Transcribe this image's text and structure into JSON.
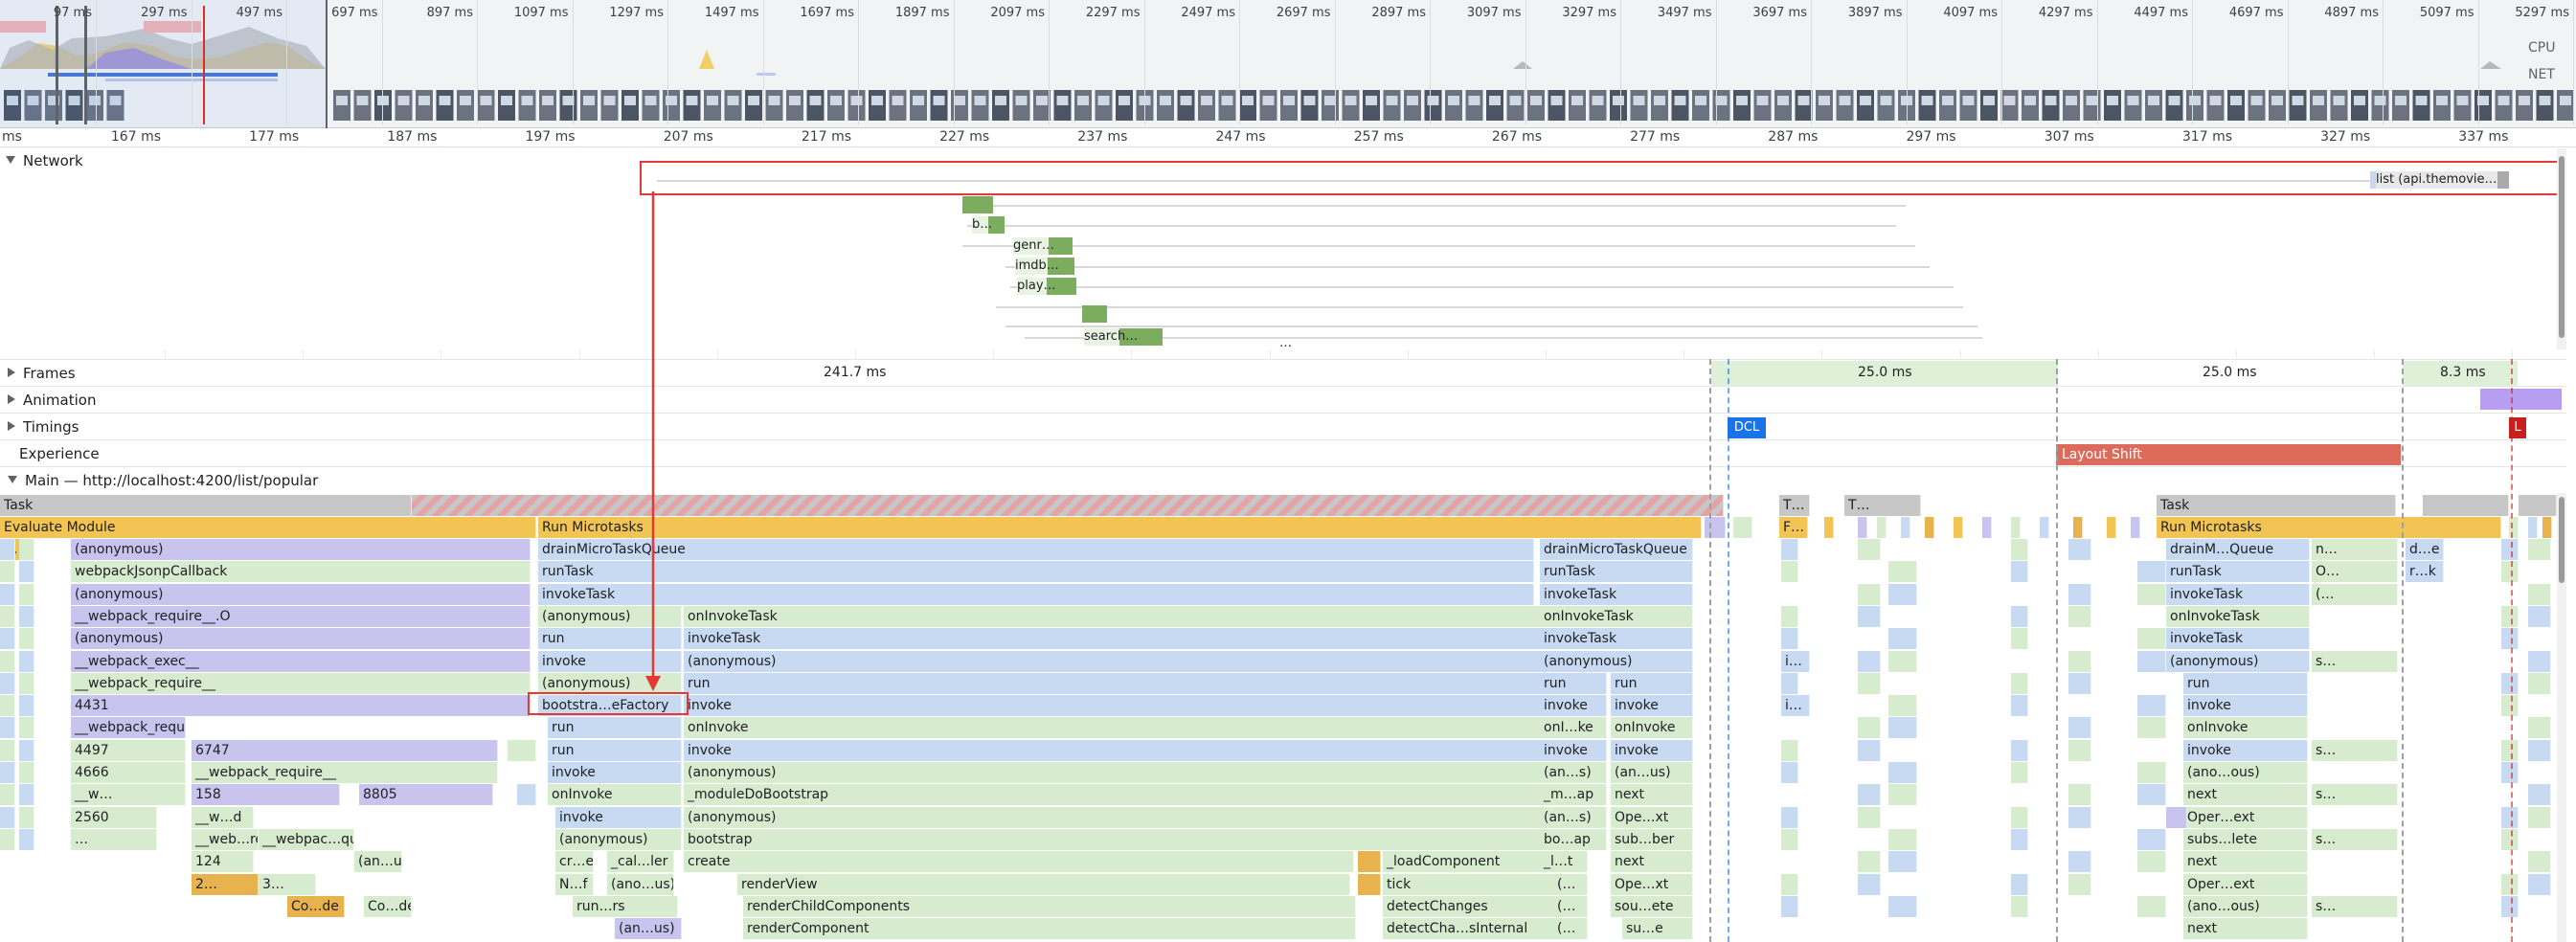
{
  "overview": {
    "ticks": [
      "97 ms",
      "297 ms",
      "497 ms",
      "697 ms",
      "897 ms",
      "1097 ms",
      "1297 ms",
      "1497 ms",
      "1697 ms",
      "1897 ms",
      "2097 ms",
      "2297 ms",
      "2497 ms",
      "2697 ms",
      "2897 ms",
      "3097 ms",
      "3297 ms",
      "3497 ms",
      "3697 ms",
      "3897 ms",
      "4097 ms",
      "4297 ms",
      "4497 ms",
      "4697 ms",
      "4897 ms",
      "5097 ms",
      "5297 ms"
    ],
    "cpu_label": "CPU",
    "net_label": "NET"
  },
  "ruler": {
    "ticks": [
      "ms",
      "167 ms",
      "177 ms",
      "187 ms",
      "197 ms",
      "207 ms",
      "217 ms",
      "227 ms",
      "237 ms",
      "247 ms",
      "257 ms",
      "267 ms",
      "277 ms",
      "287 ms",
      "297 ms",
      "307 ms",
      "317 ms",
      "327 ms",
      "337 ms"
    ]
  },
  "network": {
    "label": "Network",
    "requests": [
      {
        "label": "list (api.themovie…"
      },
      {
        "label": ""
      },
      {
        "label": "b…"
      },
      {
        "label": "genr…"
      },
      {
        "label": "imdb…"
      },
      {
        "label": "play…"
      },
      {
        "label": ""
      },
      {
        "label": "search…"
      }
    ],
    "more": "…"
  },
  "tracks": {
    "frames": "Frames",
    "frames_durations": [
      "241.7 ms",
      "25.0 ms",
      "25.0 ms",
      "8.3 ms"
    ],
    "animation": "Animation",
    "timings": "Timings",
    "dcl": "DCL",
    "lcp": "L",
    "experience": "Experience",
    "layout_shift": "Layout Shift",
    "main": "Main — http://localhost:4200/list/popular"
  },
  "flame": {
    "task": "Task",
    "task_small": [
      "T…",
      "T…",
      "Task"
    ],
    "evaluate_module": "Evaluate Module",
    "run_microtasks": "Run Microtasks",
    "run_microtasks_right": "Run Microtasks",
    "f_short": "F…",
    "left_stack": [
      "(anonymous)",
      "webpackJsonpCallback",
      "(anonymous)",
      "__webpack_require__.O",
      "(anonymous)",
      "__webpack_exec__",
      "__webpack_require__",
      "4431",
      "__webpack_require__",
      "4497",
      "4666",
      "__w…",
      "2560",
      "…"
    ],
    "left_col2": [
      "6747",
      "__webpack_require__",
      "158",
      "8805",
      "__w…d",
      "__web…re__",
      "__webpac…quire__",
      "124",
      "2…",
      "3…",
      "Co…de",
      "(an…us)",
      "Co…de"
    ],
    "c_short": "C…",
    "mid_stack": [
      "drainMicroTaskQueue",
      "runTask",
      "invokeTask",
      "(anonymous)",
      "run",
      "invoke",
      "(anonymous)",
      "bootstra…eFactory",
      "run",
      "run",
      "invoke",
      "onInvoke",
      "invoke",
      "(anonymous)",
      "cr…e",
      "N…f",
      "run…rs"
    ],
    "mid_col2": [
      "onInvokeTask",
      "invokeTask",
      "(anonymous)",
      "run",
      "invoke",
      "onInvoke",
      "invoke",
      "(anonymous)",
      "_moduleDoBootstrap",
      "(anonymous)",
      "bootstrap",
      "create",
      "_cal…ler",
      "(ano…us)",
      "(an…us)",
      "renderView",
      "renderChildComponents",
      "renderComponent"
    ],
    "mid_right": [
      "_loadComponent",
      "tick",
      "detectChanges",
      "detectCha…sInternal"
    ],
    "r1_stack": [
      "drainMicroTaskQueue",
      "runTask",
      "invokeTask",
      "onInvokeTask",
      "invokeTask",
      "(anonymous)",
      "run",
      "invoke",
      "onI…ke",
      "invoke",
      "(an…s)",
      "_m…ap",
      "(an…s)",
      "bo…ap",
      "_l…t",
      "(…",
      "(…",
      "(…"
    ],
    "r1_col2": [
      "run",
      "invoke",
      "onInvoke",
      "invoke",
      "(an…us)",
      "next",
      "Ope…xt",
      "sub…ber",
      "next",
      "Ope…xt",
      "sou…ete",
      "su…e"
    ],
    "r2_short": [
      "i…",
      "i…"
    ],
    "r3_stack": [
      "drainM…Queue",
      "runTask",
      "invokeTask",
      "onInvokeTask",
      "invokeTask",
      "(anonymous)",
      "run",
      "invoke",
      "onInvoke",
      "invoke",
      "(ano…ous)",
      "next",
      "Oper…ext",
      "subs…lete",
      "next",
      "Oper…ext",
      "(ano…ous)",
      "next"
    ],
    "r3_col2": [
      "n…",
      "O…",
      "(…",
      "s…",
      "s…",
      "s…",
      "s…",
      "s…"
    ],
    "r4_col": [
      "d…e",
      "r…k"
    ]
  },
  "colors": {
    "highlight": "#e53935",
    "dcl": "#1a73e8",
    "lcp": "#c5221f",
    "layout_shift": "#dd6b5c",
    "net_bar": "#7cad5f"
  }
}
